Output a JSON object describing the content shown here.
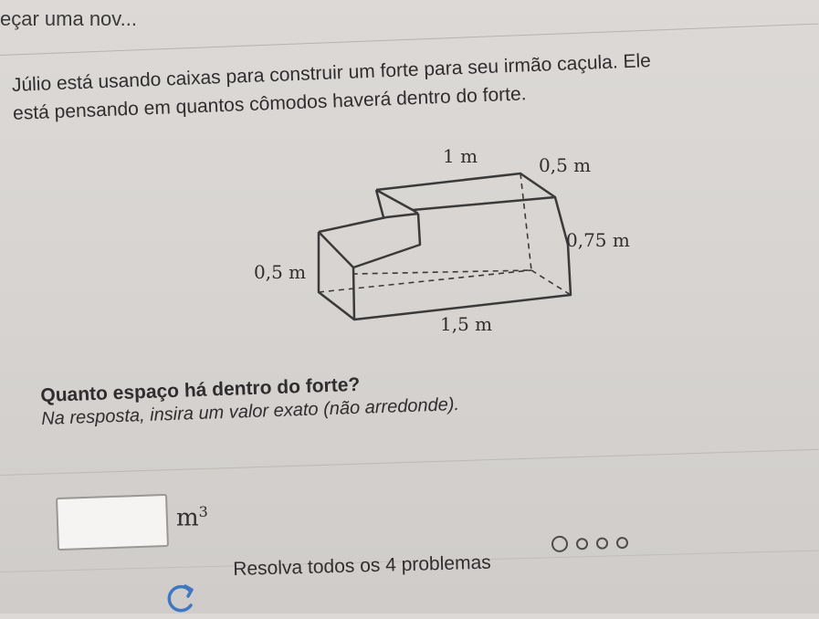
{
  "header": {
    "title": "eçar uma nov..."
  },
  "problem": {
    "line1": "Júlio está usando caixas para construir um forte para seu irmão caçula. Ele",
    "line2": "está pensando em quantos cômodos haverá dentro do forte."
  },
  "figure": {
    "labels": {
      "top_length": "1 m",
      "top_depth": "0,5 m",
      "right_height": "0,75 m",
      "left_height": "0,5 m",
      "bottom_length": "1,5 m"
    }
  },
  "question": {
    "title": "Quanto espaço há dentro do forte?",
    "instruction": "Na resposta, insira um valor exato (não arredonde)."
  },
  "answer": {
    "value": "",
    "unit": "m",
    "exponent": "3"
  },
  "footer": {
    "label": "Resolva todos os 4 problemas",
    "total_problems": 4,
    "current_problem": 1
  },
  "icons": {
    "refresh": "refresh-icon"
  },
  "colors": {
    "accent": "#3e78c2",
    "text": "#2f2d2e",
    "background": "#d9d6d3"
  }
}
